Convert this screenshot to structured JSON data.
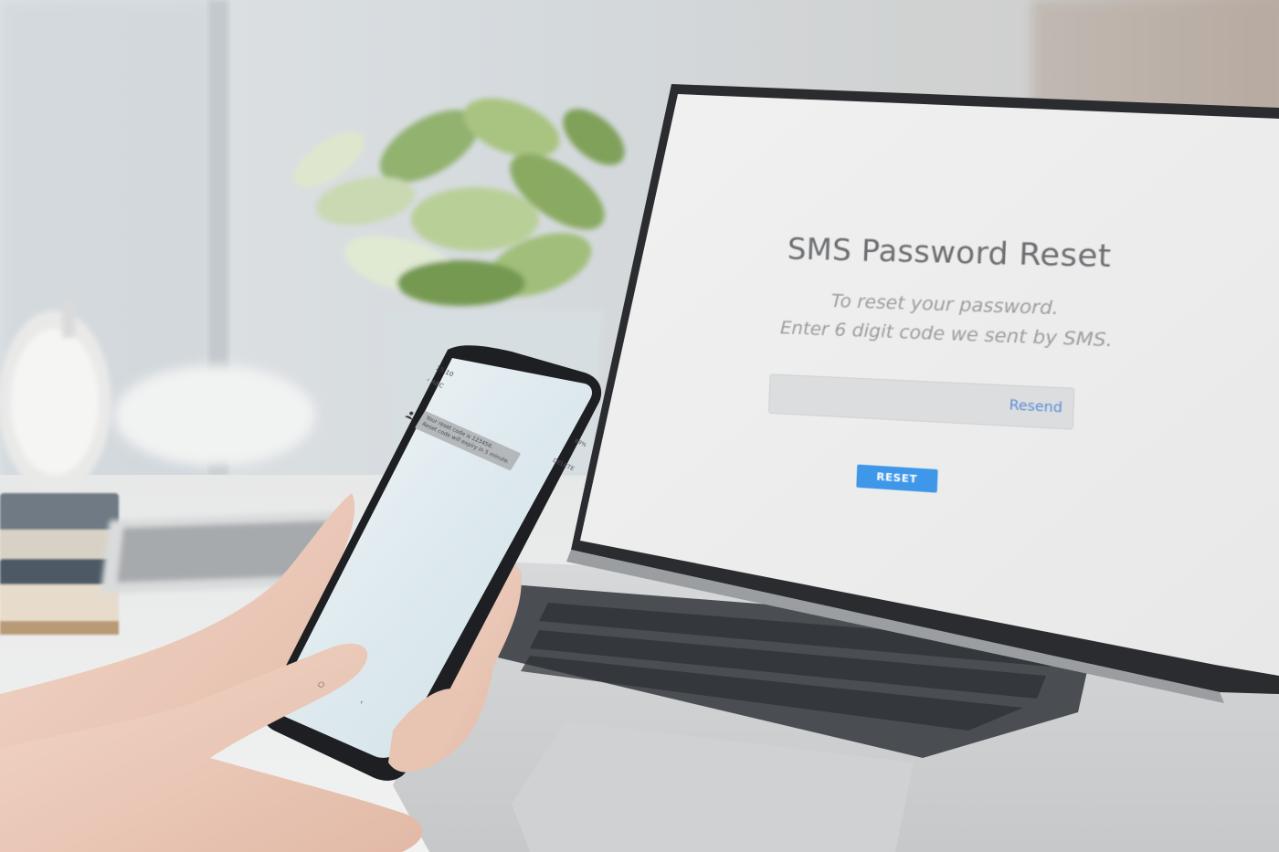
{
  "laptop_screen": {
    "title": "SMS Password Reset",
    "subtitle_line1": "To reset your password.",
    "subtitle_line2": "Enter 6 digit code we sent by SMS.",
    "resend_label": "Resend",
    "reset_button_label": "RESET",
    "accent_color": "#3f97ea"
  },
  "phone_screen": {
    "time": "15:10",
    "status": "89%",
    "back_label": "ABC",
    "delete_label": "DELETE",
    "message_line1": "Your reset code is 123456.",
    "message_line2": "Reset code will expiry in 5 minute."
  }
}
